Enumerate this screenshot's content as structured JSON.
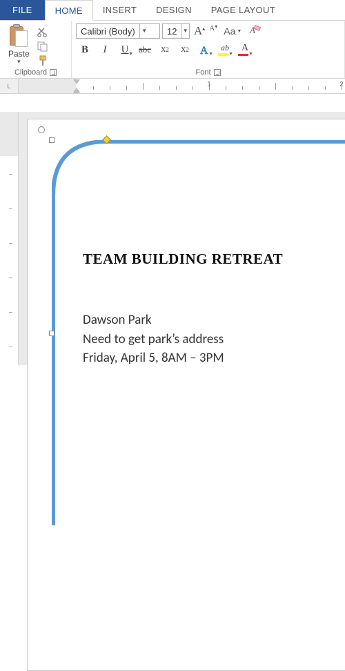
{
  "tabs": {
    "file": "FILE",
    "home": "HOME",
    "insert": "INSERT",
    "design": "DESIGN",
    "page_layout": "PAGE LAYOUT"
  },
  "clipboard": {
    "paste": "Paste",
    "group_label": "Clipboard"
  },
  "font": {
    "name": "Calibri (Body)",
    "size": "12",
    "group_label": "Font",
    "bold": "B",
    "italic": "I",
    "underline": "U",
    "strike": "abc",
    "subscript_x": "x",
    "subscript_2": "2",
    "superscript_x": "x",
    "superscript_2": "2",
    "grow_big": "A",
    "grow_small": "A",
    "case": "Aa",
    "highlight_a": "ab",
    "fontcolor_a": "A",
    "effect_a": "A"
  },
  "ruler": {
    "corner": "L",
    "n1": "1",
    "n2": "2"
  },
  "document": {
    "title": "TEAM BUILDING RETREAT",
    "line1": "Dawson Park",
    "line2": "Need to get park’s address",
    "line3": "Friday, April 5, 8AM – 3PM"
  }
}
